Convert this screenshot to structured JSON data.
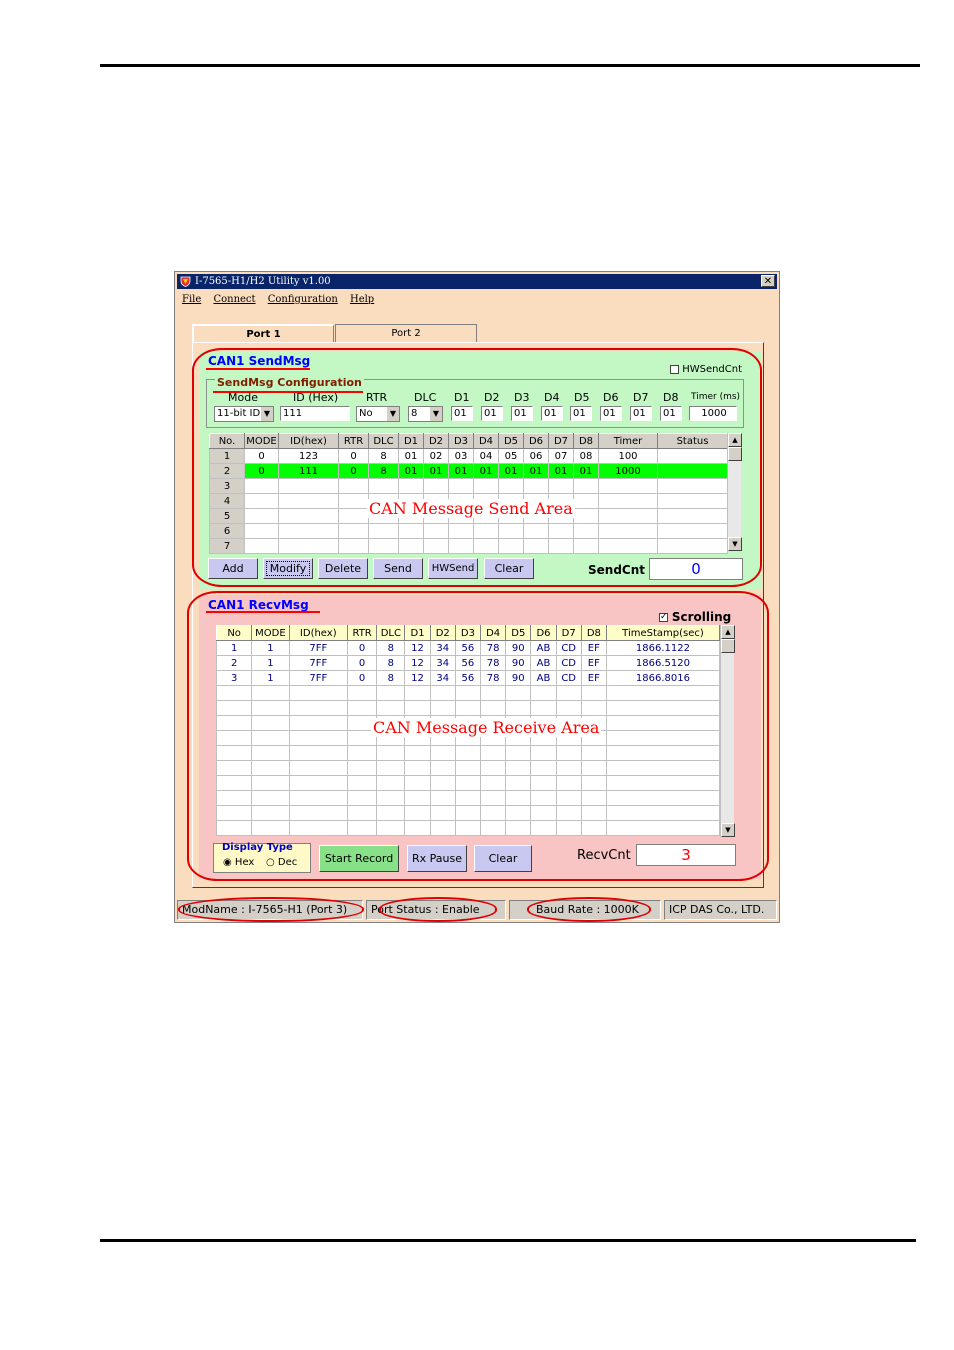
{
  "window": {
    "title": "I-7565-H1/H2 Utility v1.00",
    "close_glyph": "✕",
    "menu": [
      "File",
      "Connect",
      "Configuration",
      "Help"
    ],
    "tabs": [
      "Port 1",
      "Port 2"
    ]
  },
  "send": {
    "section_label": "CAN1 SendMsg",
    "hwsendcnt_label": "HWSendCnt",
    "config_label": "SendMsg Configuration",
    "field_labels": [
      "Mode",
      "ID (Hex)",
      "RTR",
      "DLC",
      "D1",
      "D2",
      "D3",
      "D4",
      "D5",
      "D6",
      "D7",
      "D8",
      "Timer (ms)"
    ],
    "mode_value": "11-bit ID",
    "id_value": "111",
    "rtr_value": "No",
    "dlc_value": "8",
    "data_values": [
      "01",
      "01",
      "01",
      "01",
      "01",
      "01",
      "01",
      "01"
    ],
    "timer_value": "1000",
    "columns": [
      "No.",
      "MODE",
      "ID(hex)",
      "RTR",
      "DLC",
      "D1",
      "D2",
      "D3",
      "D4",
      "D5",
      "D6",
      "D7",
      "D8",
      "Timer",
      "Status"
    ],
    "rows": [
      [
        "1",
        "0",
        "123",
        "0",
        "8",
        "01",
        "02",
        "03",
        "04",
        "05",
        "06",
        "07",
        "08",
        "100",
        ""
      ],
      [
        "2",
        "0",
        "111",
        "0",
        "8",
        "01",
        "01",
        "01",
        "01",
        "01",
        "01",
        "01",
        "01",
        "1000",
        ""
      ],
      [
        "3",
        "",
        "",
        "",
        "",
        "",
        "",
        "",
        "",
        "",
        "",
        "",
        "",
        "",
        ""
      ],
      [
        "4",
        "",
        "",
        "",
        "",
        "",
        "",
        "",
        "",
        "",
        "",
        "",
        "",
        "",
        ""
      ],
      [
        "5",
        "",
        "",
        "",
        "",
        "",
        "",
        "",
        "",
        "",
        "",
        "",
        "",
        "",
        ""
      ],
      [
        "6",
        "",
        "",
        "",
        "",
        "",
        "",
        "",
        "",
        "",
        "",
        "",
        "",
        "",
        ""
      ],
      [
        "7",
        "",
        "",
        "",
        "",
        "",
        "",
        "",
        "",
        "",
        "",
        "",
        "",
        "",
        ""
      ]
    ],
    "selected_row": 2,
    "area_annotation": "CAN Message Send Area",
    "buttons": [
      "Add",
      "Modify",
      "Delete",
      "Send",
      "HWSend",
      "Clear"
    ],
    "sendcnt_label": "SendCnt",
    "sendcnt_value": "0"
  },
  "recv": {
    "section_label": "CAN1 RecvMsg",
    "scrolling_label": "Scrolling",
    "scrolling_checked": true,
    "columns": [
      "No",
      "MODE",
      "ID(hex)",
      "RTR",
      "DLC",
      "D1",
      "D2",
      "D3",
      "D4",
      "D5",
      "D6",
      "D7",
      "D8",
      "TimeStamp(sec)"
    ],
    "rows": [
      [
        "1",
        "1",
        "7FF",
        "0",
        "8",
        "12",
        "34",
        "56",
        "78",
        "90",
        "AB",
        "CD",
        "EF",
        "1866.1122"
      ],
      [
        "2",
        "1",
        "7FF",
        "0",
        "8",
        "12",
        "34",
        "56",
        "78",
        "90",
        "AB",
        "CD",
        "EF",
        "1866.5120"
      ],
      [
        "3",
        "1",
        "7FF",
        "0",
        "8",
        "12",
        "34",
        "56",
        "78",
        "90",
        "AB",
        "CD",
        "EF",
        "1866.8016"
      ]
    ],
    "empty_rows": 10,
    "area_annotation": "CAN Message Receive Area",
    "display_type_label": "Display Type",
    "display_options": [
      "Hex",
      "Dec"
    ],
    "display_selected": "Hex",
    "buttons": [
      "Start Record",
      "Rx Pause",
      "Clear"
    ],
    "recvcnt_label": "RecvCnt",
    "recvcnt_value": "3"
  },
  "statusbar": [
    "ModName : I-7565-H1 (Port 3)",
    "Port Status : Enable",
    "Baud Rate : 1000K",
    "ICP DAS Co., LTD."
  ],
  "colors": {
    "send_panel": "#c3f8c5",
    "recv_panel": "#f8c4c4",
    "window_bg": "#fadcbe",
    "selected_row": "#00ff00",
    "annotation": "#ff0000"
  }
}
